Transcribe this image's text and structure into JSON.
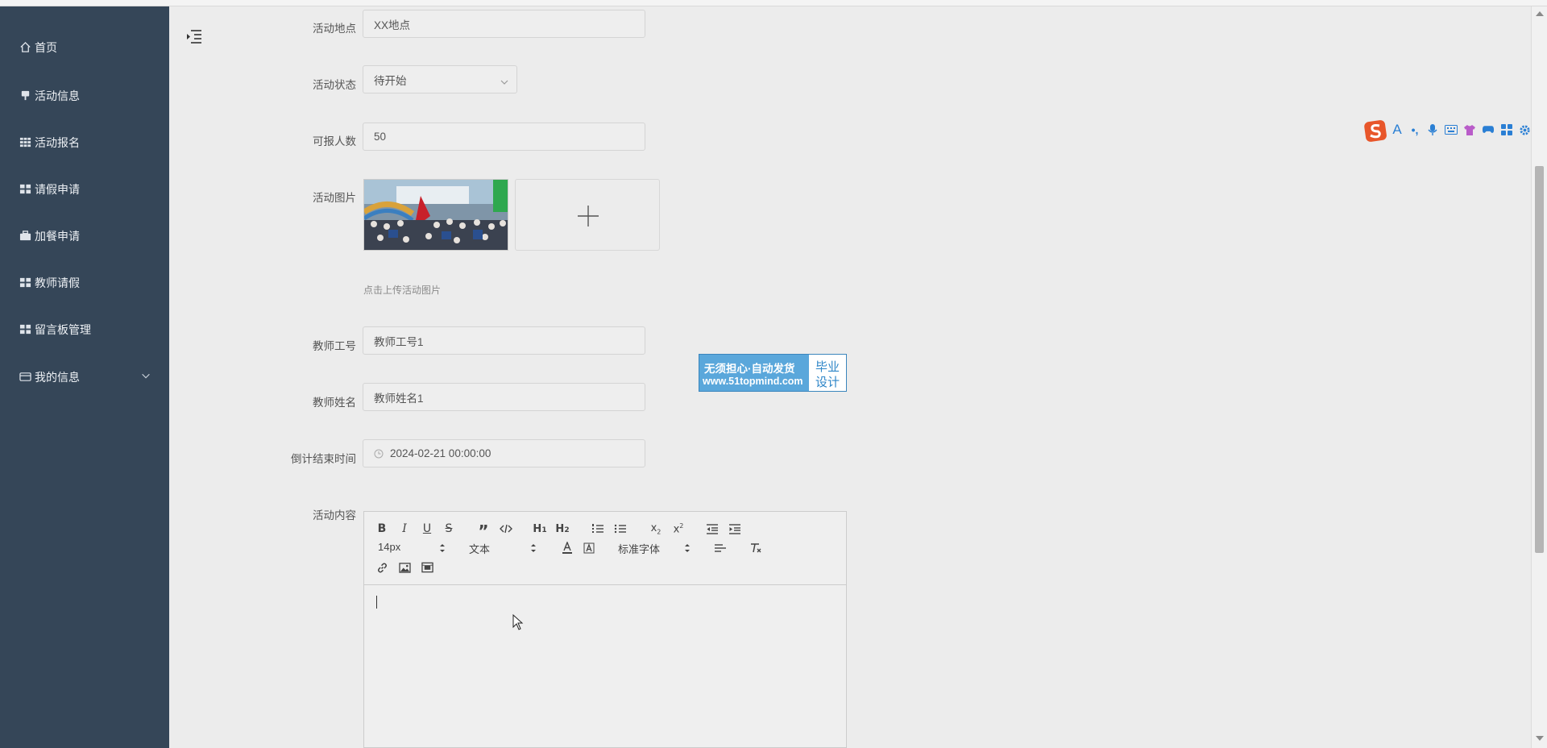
{
  "sidebar": {
    "items": [
      {
        "label": "首页",
        "icon": "home-icon"
      },
      {
        "label": "活动信息",
        "icon": "pin-icon"
      },
      {
        "label": "活动报名",
        "icon": "grid-icon"
      },
      {
        "label": "请假申请",
        "icon": "grid-icon"
      },
      {
        "label": "加餐申请",
        "icon": "briefcase-icon"
      },
      {
        "label": "教师请假",
        "icon": "grid-icon"
      },
      {
        "label": "留言板管理",
        "icon": "grid-icon"
      },
      {
        "label": "我的信息",
        "icon": "card-icon",
        "expandable": true
      }
    ]
  },
  "form": {
    "location": {
      "label": "活动地点",
      "value": "XX地点"
    },
    "status": {
      "label": "活动状态",
      "value": "待开始"
    },
    "capacity": {
      "label": "可报人数",
      "value": "50"
    },
    "image": {
      "label": "活动图片",
      "hint": "点击上传活动图片"
    },
    "teacher_id": {
      "label": "教师工号",
      "value": "教师工号1"
    },
    "teacher_name": {
      "label": "教师姓名",
      "value": "教师姓名1"
    },
    "countdown_end": {
      "label": "倒计结束时间",
      "value": "2024-02-21 00:00:00"
    },
    "content": {
      "label": "活动内容"
    }
  },
  "editor": {
    "font_size": "14px",
    "header_select": "文本",
    "font_family": "标准字体",
    "buttons": [
      "bold",
      "italic",
      "underline",
      "strike",
      "blockquote",
      "code-block",
      "h1",
      "h2",
      "ordered-list",
      "bullet-list",
      "subscript",
      "superscript",
      "outdent",
      "indent",
      "font-color",
      "background-color",
      "align",
      "clean",
      "link",
      "image",
      "video"
    ]
  },
  "ad": {
    "line1": "无须担心·自动发货",
    "line2": "www.51topmind.com",
    "right1": "毕业",
    "right2": "设计"
  },
  "colors": {
    "sidebar_bg": "#354658",
    "page_bg": "#ececec",
    "ad_blue": "#5aa7db",
    "ime_orange": "#e8562a"
  }
}
